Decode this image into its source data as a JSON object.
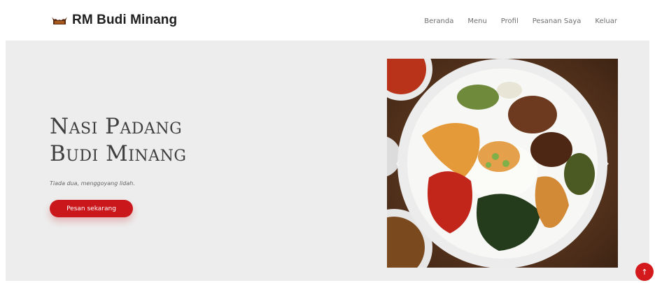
{
  "header": {
    "brand_name": "RM Budi Minang",
    "logo_icon": "rumah-gadang-icon",
    "nav": [
      {
        "label": "Beranda"
      },
      {
        "label": "Menu"
      },
      {
        "label": "Profil"
      },
      {
        "label": "Pesanan Saya"
      },
      {
        "label": "Keluar"
      }
    ]
  },
  "hero": {
    "title_line1": "Nasi Padang",
    "title_line2": "Budi Minang",
    "tagline": "Tiada dua, menggoyang lidah.",
    "cta_label": "Pesan sekarang",
    "prev_icon": "‹",
    "next_icon": "›"
  },
  "back_to_top": {
    "icon": "↑"
  },
  "colors": {
    "accent": "#c9171b",
    "hero_bg": "#ededed",
    "text_dark": "#1f1f1f"
  }
}
